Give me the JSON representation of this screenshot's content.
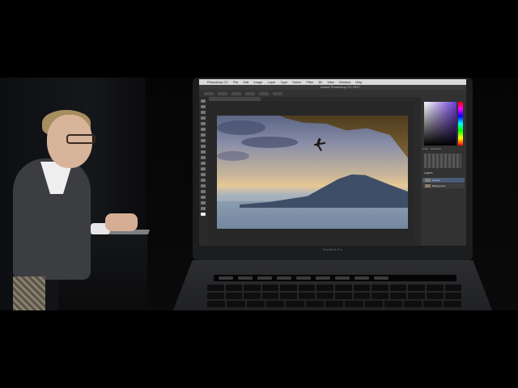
{
  "photoshop": {
    "apple_glyph": "",
    "menu": [
      "Photoshop CC",
      "File",
      "Edit",
      "Image",
      "Layer",
      "Type",
      "Select",
      "Filter",
      "3D",
      "View",
      "Window",
      "Help"
    ],
    "window_title": "Adobe Photoshop CC 2017",
    "doc_tab": "Adobe Stock Image.tif @ 100% (Climber, RGB/8)",
    "panel_tabs": [
      "Color",
      "Swatches"
    ],
    "layers_label": "Layers",
    "layers": [
      "Climber",
      "Background"
    ]
  },
  "laptop": {
    "bezel_label": "MacBook Pro"
  },
  "colors": {
    "accent_layer": "#4a5b76",
    "hue_purple": "#6b3bd6"
  }
}
